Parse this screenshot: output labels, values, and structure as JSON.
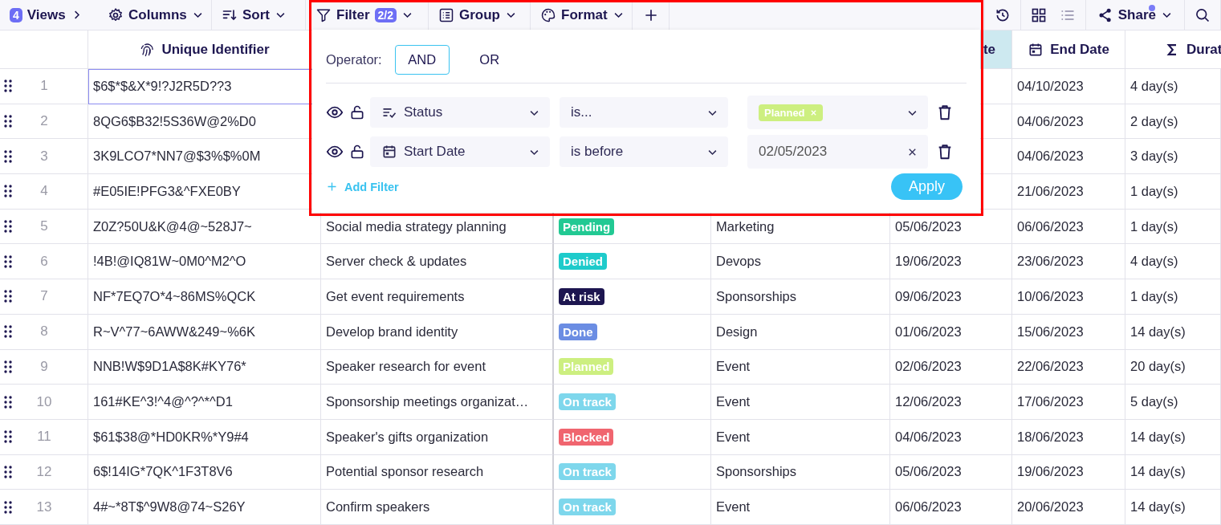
{
  "toolbar": {
    "items": [
      {
        "kind": "views",
        "label": "Views",
        "badge": "4"
      },
      {
        "kind": "columns",
        "label": "Columns"
      },
      {
        "kind": "sort",
        "label": "Sort"
      },
      {
        "kind": "filter",
        "label": "Filter",
        "badge": "2/2"
      },
      {
        "kind": "group",
        "label": "Group"
      },
      {
        "kind": "format",
        "label": "Format"
      }
    ],
    "share": {
      "label": "Share",
      "notify": true
    }
  },
  "table": {
    "columns": [
      {
        "kind": "id",
        "label": "Unique Identifier",
        "highlighted": false
      },
      {
        "kind": "name"
      },
      {
        "kind": "status"
      },
      {
        "kind": "category"
      },
      {
        "kind": "start",
        "label": "te",
        "highlighted": true
      },
      {
        "kind": "end",
        "label": "End Date",
        "highlighted": false
      },
      {
        "kind": "duration",
        "label": "Durat",
        "highlighted": false
      }
    ],
    "rows": [
      {
        "number": "1",
        "id": "$6$*$&X*9!?J2R5D??3",
        "selected": true,
        "end": "04/10/2023",
        "duration": "4 day(s)"
      },
      {
        "number": "2",
        "id": "8QG6$B32!5S36W@2%D0",
        "selected": false,
        "end": "04/06/2023",
        "duration": "2 day(s)"
      },
      {
        "number": "3",
        "id": "3K9LCO7*NN7@$3%$%0M",
        "selected": false,
        "end": "04/06/2023",
        "duration": "3 day(s)"
      },
      {
        "number": "4",
        "id": "#E05IE!PFG3&^FXE0BY",
        "selected": false,
        "end": "21/06/2023",
        "duration": "1 day(s)"
      },
      {
        "number": "5",
        "id": "Z0Z?50U&K@4@~528J7~",
        "selected": false,
        "name": "Social media strategy planning",
        "status": {
          "label": "Pending",
          "color": "#22c993"
        },
        "category": "Marketing",
        "start": "05/06/2023",
        "end": "06/06/2023",
        "duration": "1 day(s)"
      },
      {
        "number": "6",
        "id": "!4B!@IQ81W~0M0^M2^O",
        "selected": false,
        "name": "Server check & updates",
        "status": {
          "label": "Denied",
          "color": "#1ecbcb"
        },
        "category": "Devops",
        "start": "19/06/2023",
        "end": "23/06/2023",
        "duration": "4 day(s)"
      },
      {
        "number": "7",
        "id": "NF*7EQ7O*4~86MS%QCK",
        "selected": false,
        "name": "Get event requirements",
        "status": {
          "label": "At risk",
          "color": "#1d1650"
        },
        "category": "Sponsorships",
        "start": "09/06/2023",
        "end": "10/06/2023",
        "duration": "1 day(s)"
      },
      {
        "number": "8",
        "id": "R~V^77~6AWW&249~%6K",
        "selected": false,
        "name": "Develop brand identity",
        "status": {
          "label": "Done",
          "color": "#6b8de3"
        },
        "category": "Design",
        "start": "01/06/2023",
        "end": "15/06/2023",
        "duration": "14 day(s)"
      },
      {
        "number": "9",
        "id": "NNB!W$9D1A$8K#KY76*",
        "selected": false,
        "name": "Speaker research for event",
        "status": {
          "label": "Planned",
          "color": "#cdef80"
        },
        "category": "Event",
        "start": "02/06/2023",
        "end": "22/06/2023",
        "duration": "20 day(s)"
      },
      {
        "number": "10",
        "id": "161#KE^3!^4@^?^*^D1",
        "selected": false,
        "name": "Sponsorship meetings organizat…",
        "status": {
          "label": "On track",
          "color": "#7ed7ec"
        },
        "category": "Event",
        "start": "12/06/2023",
        "end": "17/06/2023",
        "duration": "5 day(s)"
      },
      {
        "number": "11",
        "id": "$61$38@*HD0KR%*Y9#4",
        "selected": false,
        "name": "Speaker's gifts organization",
        "status": {
          "label": "Blocked",
          "color": "#f0656f"
        },
        "category": "Event",
        "start": "04/06/2023",
        "end": "18/06/2023",
        "duration": "14 day(s)"
      },
      {
        "number": "12",
        "id": "6$!14IG*7QK^1F3T8V6",
        "selected": false,
        "name": "Potential sponsor research",
        "status": {
          "label": "On track",
          "color": "#7ed7ec"
        },
        "category": "Sponsorships",
        "start": "05/06/2023",
        "end": "19/06/2023",
        "duration": "14 day(s)"
      },
      {
        "number": "13",
        "id": "4#~*8T$^9W8@74~S26Y",
        "selected": false,
        "name": "Confirm speakers",
        "status": {
          "label": "On track",
          "color": "#7ed7ec"
        },
        "category": "Event",
        "start": "06/06/2023",
        "end": "20/06/2023",
        "duration": "14 day(s)"
      }
    ]
  },
  "filter_panel": {
    "operator_label": "Operator:",
    "operators": [
      {
        "label": "AND",
        "selected": true
      },
      {
        "label": "OR",
        "selected": false
      }
    ],
    "filters": [
      {
        "kind": "status",
        "visible": true,
        "locked": false,
        "field": "Status",
        "condition": "is...",
        "tags": [
          {
            "label": "Planned",
            "color": "#cdef80"
          }
        ]
      },
      {
        "kind": "date",
        "visible": true,
        "locked": false,
        "field": "Start Date",
        "condition": "is before",
        "value": "02/05/2023"
      }
    ],
    "add_label": "Add Filter",
    "apply_label": "Apply"
  }
}
